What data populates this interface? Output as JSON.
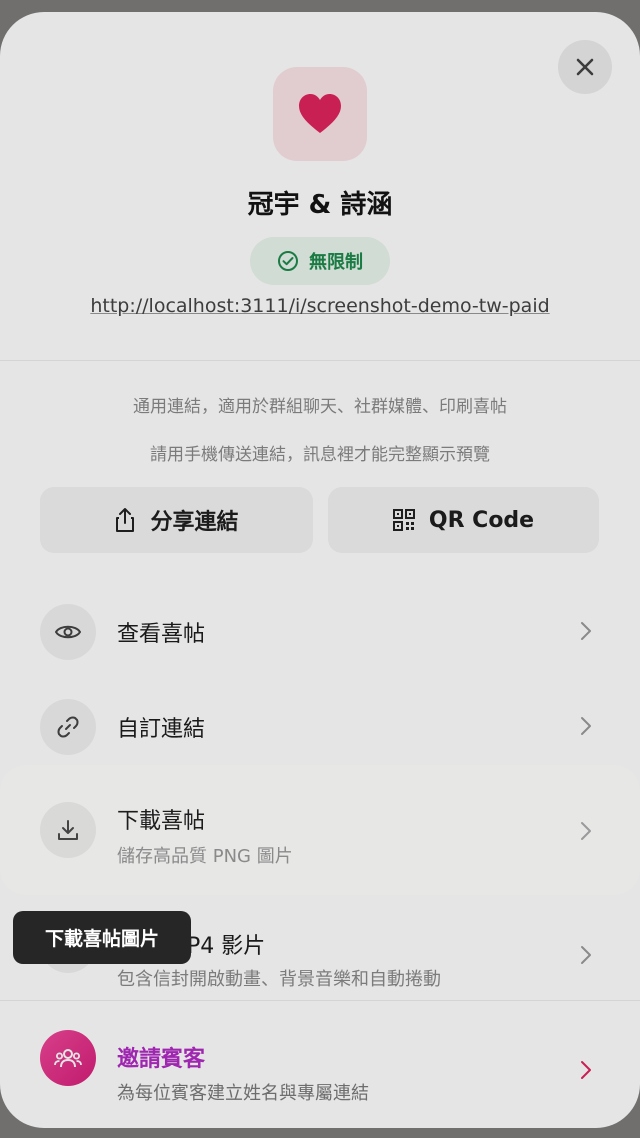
{
  "header": {
    "couple_name": "冠宇 & 詩涵",
    "plan_badge": "無限制",
    "share_url": "http://localhost:3111/i/screenshot-demo-tw-paid"
  },
  "helper": {
    "line1": "通用連結，適用於群組聊天、社群媒體、印刷喜帖",
    "line2": "請用手機傳送連結，訊息裡才能完整顯示預覽"
  },
  "actions": {
    "share_label": "分享連結",
    "qr_label": "QR Code"
  },
  "menu": [
    {
      "title": "查看喜帖",
      "subtitle": "",
      "icon": "eye-icon"
    },
    {
      "title": "自訂連結",
      "subtitle": "",
      "icon": "link-icon"
    },
    {
      "title": "下載喜帖",
      "subtitle": "儲存高品質 PNG 圖片",
      "icon": "download-icon"
    },
    {
      "title": "下載 MP4 影片",
      "subtitle": "包含信封開啟動畫、背景音樂和自動捲動",
      "icon": "video-icon"
    },
    {
      "title": "邀請賓客",
      "subtitle": "為每位賓客建立姓名與專屬連結",
      "icon": "guests-icon"
    }
  ],
  "tooltip": "下載喜帖圖片",
  "colors": {
    "accent_pink": "#e0245e",
    "badge_green": "#1f8a4c",
    "invite_purple": "#b12bc4"
  }
}
